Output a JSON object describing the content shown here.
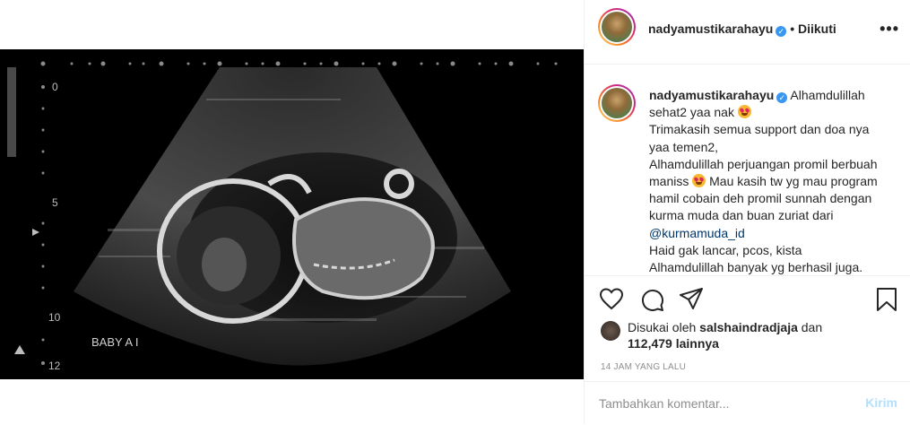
{
  "post": {
    "username": "nadyamustikarahayu",
    "verified_icon": "verified-badge-icon",
    "follow_separator": "•",
    "follow_status": "Diikuti",
    "more_icon": "more-options-icon",
    "more_label": "•••",
    "media_alt": "Ultrasound scan image",
    "ultrasound": {
      "label": "BABY A I",
      "scale": [
        "0",
        "5",
        "10",
        "12"
      ]
    }
  },
  "caption": {
    "username": "nadyamustikarahayu",
    "lines": [
      "Alhamdulillah sehat2 yaa nak",
      "Trimakasih semua support dan doa nya yaa temen2,",
      "Alhamdulillah perjuangan promil berbuah maniss",
      "Mau kasih tw yg mau program hamil cobain deh promil sunnah dengan kurma muda dan buan zuriat dari",
      "@kurmamuda_id",
      "Haid gak lancar, pcos, kista",
      "Alhamdulillah banyak yg berhasil juga."
    ],
    "emoji_icon": "heart-eyes-emoji-icon"
  },
  "actions": {
    "like_icon": "heart-icon",
    "comment_icon": "comment-icon",
    "share_icon": "paper-plane-icon",
    "save_icon": "bookmark-icon"
  },
  "likes": {
    "prefix": "Disukai oleh",
    "user": "salshaindradjaja",
    "and": "dan",
    "count": "112,479 lainnya"
  },
  "timestamp": "14 JAM YANG LALU",
  "comment": {
    "placeholder": "Tambahkan komentar...",
    "send_label": "Kirim"
  },
  "colors": {
    "verified": "#3897f0",
    "link": "#00376b",
    "send_disabled": "#b2dffc",
    "muted": "#8e8e8e"
  }
}
